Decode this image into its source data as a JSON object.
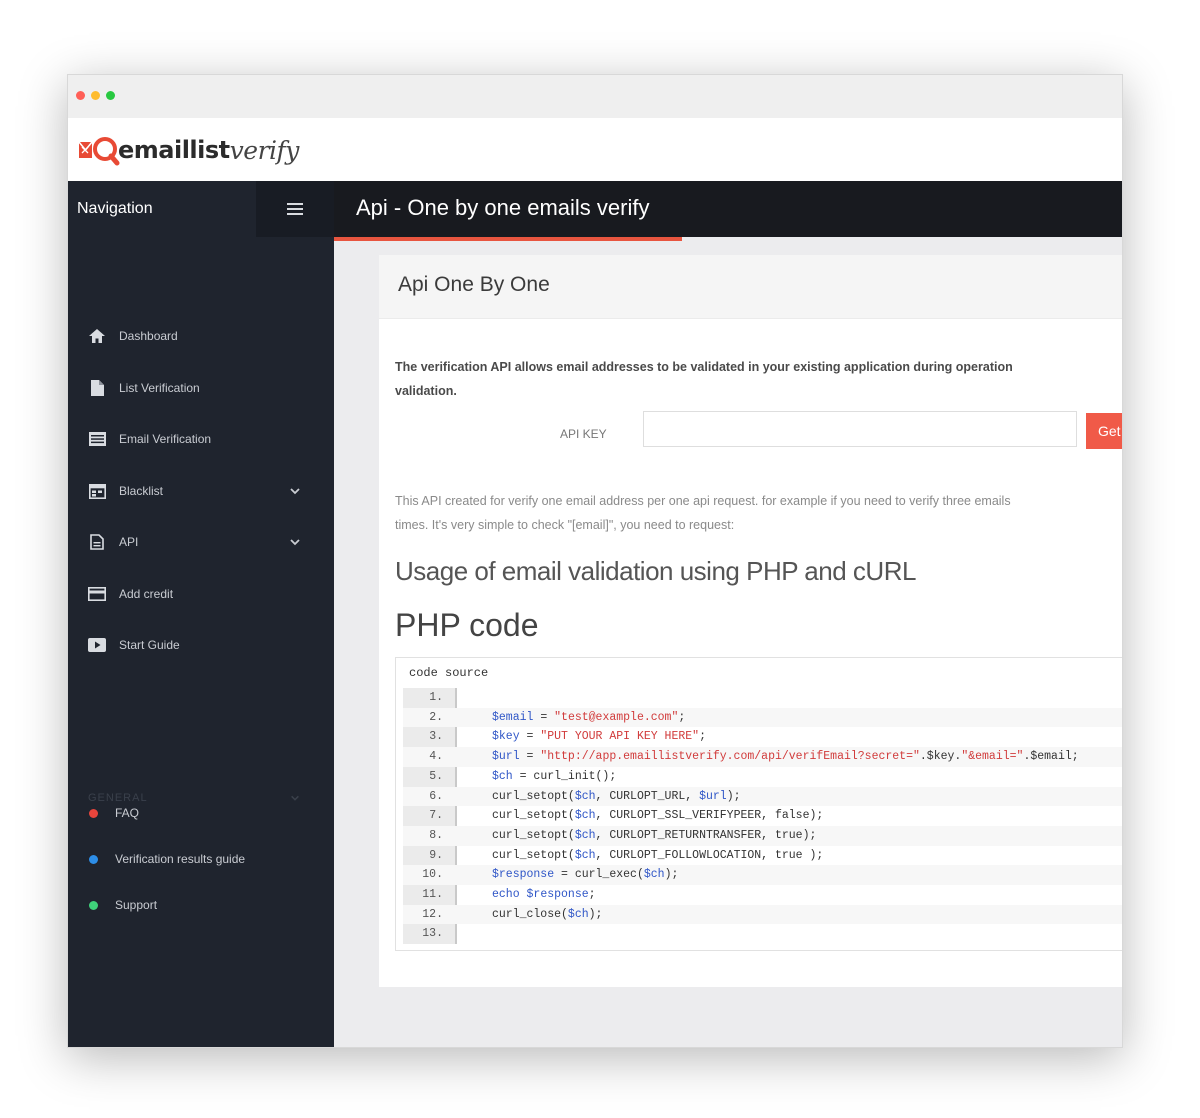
{
  "brand": {
    "part1": "emaillist",
    "part2": "verify"
  },
  "sidebar": {
    "title": "Navigation",
    "items": [
      {
        "label": "Dashboard",
        "icon": "home-icon"
      },
      {
        "label": "List Verification",
        "icon": "file-icon"
      },
      {
        "label": "Email Verification",
        "icon": "list-icon"
      },
      {
        "label": "Blacklist",
        "icon": "calendar-icon",
        "has_chevron": true
      },
      {
        "label": "API",
        "icon": "document-icon",
        "has_chevron": true
      },
      {
        "label": "Add credit",
        "icon": "credit-card-icon"
      },
      {
        "label": "Start Guide",
        "icon": "video-icon"
      }
    ],
    "section_label": "GENERAL",
    "links": [
      {
        "label": "FAQ",
        "color": "#e8453c"
      },
      {
        "label": "Verification results guide",
        "color": "#2d8ee8"
      },
      {
        "label": "Support",
        "color": "#3fd17a"
      }
    ]
  },
  "header": {
    "title": "Api - One by one emails verify"
  },
  "card": {
    "title": "Api One By One",
    "intro_line1": "The verification API allows email addresses to be validated in your existing application during operation",
    "intro_line2": "validation.",
    "api_key_label": "API KEY",
    "api_key_value": "",
    "get_button_label": "Get",
    "desc_line1": "This API created for verify one email address per one api request. for example if you need to verify three emails",
    "desc_line2": "times. It's very simple to check \"[email]\", you need to request:",
    "usage_title": "Usage of email validation using PHP and cURL",
    "php_title": "PHP code",
    "code_header": "code source"
  },
  "code": {
    "line_numbers": [
      "1.",
      "2.",
      "3.",
      "4.",
      "5.",
      "6.",
      "7.",
      "8.",
      "9.",
      "10.",
      "11.",
      "12.",
      "13."
    ],
    "lines": [
      [],
      [
        {
          "t": "$email",
          "c": "var"
        },
        {
          "t": " = ",
          "c": ""
        },
        {
          "t": "\"test@example.com\"",
          "c": "str"
        },
        {
          "t": ";",
          "c": ""
        }
      ],
      [
        {
          "t": "$key",
          "c": "var"
        },
        {
          "t": " = ",
          "c": ""
        },
        {
          "t": "\"PUT YOUR API KEY HERE\"",
          "c": "str"
        },
        {
          "t": ";",
          "c": ""
        }
      ],
      [
        {
          "t": "$url",
          "c": "var"
        },
        {
          "t": " = ",
          "c": ""
        },
        {
          "t": "\"http://app.emaillistverify.com/api/verifEmail?secret=\"",
          "c": "str"
        },
        {
          "t": ".$key.",
          "c": ""
        },
        {
          "t": "\"&email=\"",
          "c": "str"
        },
        {
          "t": ".$email;",
          "c": ""
        }
      ],
      [
        {
          "t": "$ch",
          "c": "var"
        },
        {
          "t": " = curl_init();",
          "c": ""
        }
      ],
      [
        {
          "t": "curl_setopt(",
          "c": ""
        },
        {
          "t": "$ch",
          "c": "var"
        },
        {
          "t": ", CURLOPT_URL, ",
          "c": ""
        },
        {
          "t": "$url",
          "c": "var"
        },
        {
          "t": ");",
          "c": ""
        }
      ],
      [
        {
          "t": "curl_setopt(",
          "c": ""
        },
        {
          "t": "$ch",
          "c": "var"
        },
        {
          "t": ", CURLOPT_SSL_VERIFYPEER, false);",
          "c": ""
        }
      ],
      [
        {
          "t": "curl_setopt(",
          "c": ""
        },
        {
          "t": "$ch",
          "c": "var"
        },
        {
          "t": ", CURLOPT_RETURNTRANSFER, true);",
          "c": ""
        }
      ],
      [
        {
          "t": "curl_setopt(",
          "c": ""
        },
        {
          "t": "$ch",
          "c": "var"
        },
        {
          "t": ", CURLOPT_FOLLOWLOCATION, true );",
          "c": ""
        }
      ],
      [
        {
          "t": "$response",
          "c": "var"
        },
        {
          "t": " = curl_exec(",
          "c": ""
        },
        {
          "t": "$ch",
          "c": "var"
        },
        {
          "t": ");",
          "c": ""
        }
      ],
      [
        {
          "t": "echo ",
          "c": "kw"
        },
        {
          "t": "$response",
          "c": "var"
        },
        {
          "t": ";",
          "c": ""
        }
      ],
      [
        {
          "t": "curl_close(",
          "c": ""
        },
        {
          "t": "$ch",
          "c": "var"
        },
        {
          "t": ");",
          "c": ""
        }
      ],
      []
    ]
  },
  "colors": {
    "accent": "#e8553f",
    "sidebar_bg": "#1f242e",
    "header_bg": "#181a1f",
    "button": "#f05a48"
  }
}
